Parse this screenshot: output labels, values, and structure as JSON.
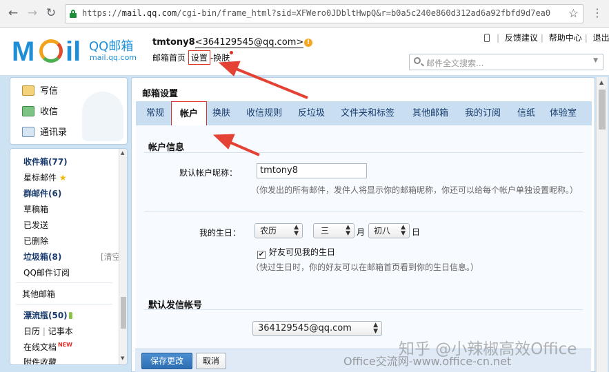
{
  "browser": {
    "url_prefix": "https://",
    "url_host": "mail.qq.com",
    "url_rest": "/cgi-bin/frame_html?sid=XFWero0JDbltHwpQ&r=b0a5c240e860d312ad6a92fbfd9d7ea0"
  },
  "header": {
    "logo_name": "QQ邮箱",
    "logo_sub": "mail.qq.com",
    "username": "tmtony8",
    "email": "<364129545@qq.com>",
    "links": {
      "home": "邮箱首页",
      "settings": "设置",
      "dash": " - ",
      "skin": "换肤"
    },
    "toplinks": [
      "反馈建议",
      "帮助中心",
      "退出"
    ],
    "search_placeholder": "邮件全文搜索..."
  },
  "left_top": [
    {
      "label": "写信"
    },
    {
      "label": "收信"
    },
    {
      "label": "通讯录"
    }
  ],
  "folders": {
    "inbox": "收件箱(77)",
    "starred": "星标邮件",
    "group": "群邮件(6)",
    "drafts": "草稿箱",
    "sent": "已发送",
    "deleted": "已删除",
    "spam": "垃圾箱(8)",
    "spam_clear": "[清空]",
    "subscriptions": "QQ邮件订阅",
    "other": "其他邮箱",
    "drift": "漂流瓶(50)",
    "calendar": "日历",
    "calendar_sep": "|",
    "notes": "记事本",
    "docs": "在线文档",
    "docs_tag": "NEW",
    "attachments": "附件收藏"
  },
  "content": {
    "title": "邮箱设置",
    "tabs": [
      "常规",
      "帐户",
      "换肤",
      "收信规则",
      "反垃圾",
      "文件夹和标签",
      "其他邮箱",
      "我的订阅",
      "信纸",
      "体验室"
    ],
    "active_tab": "帐户",
    "account_section": "帐户信息",
    "nickname_label": "默认帐户昵称：",
    "nickname_value": "tmtony8",
    "nickname_hint": "（你发出的所有邮件，发件人将显示你的邮箱昵称，你还可以给每个帐户单独设置昵称。）",
    "birthday_label": "我的生日：",
    "calendar_type": "农历",
    "month": "三",
    "month_unit": "月",
    "day": "初八",
    "day_unit": "日",
    "birthday_visible_label": "好友可见我的生日",
    "birthday_visible_checked": true,
    "birthday_hint": "（快过生日时，你的好友可以在邮箱首页看到你的生日信息。）",
    "sender_section": "默认发信帐号",
    "sender_value": "364129545@qq.com",
    "save_button": "保存更改",
    "cancel_button": "取消"
  },
  "watermarks": {
    "zhihu": "知乎 @小辣椒高效Office",
    "site": "Office交流网-www.office-cn.net"
  },
  "colors": {
    "brand_blue": "#1e8fd6",
    "annotation_red": "#e0302a",
    "tab_bar": "#c9dff1",
    "save_blue": "#2d6eb3"
  }
}
